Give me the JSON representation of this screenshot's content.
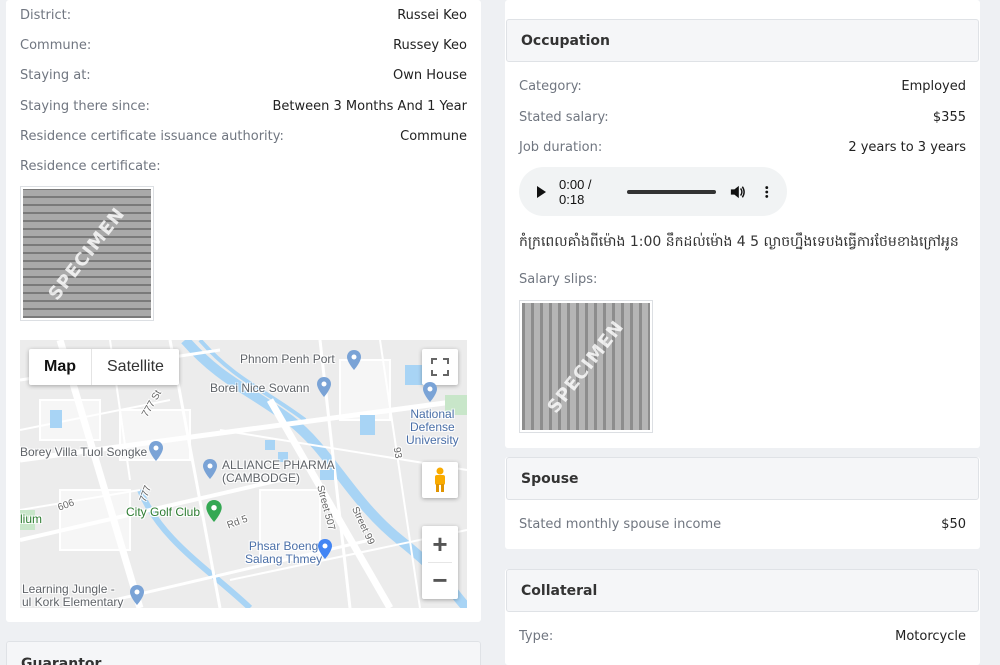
{
  "residence": {
    "fields": [
      {
        "label": "District:",
        "value": "Russei Keo"
      },
      {
        "label": "Commune:",
        "value": "Russey Keo"
      },
      {
        "label": "Staying at:",
        "value": "Own House"
      },
      {
        "label": "Staying there since:",
        "value": "Between 3 Months And 1 Year"
      },
      {
        "label": "Residence certificate issuance authority:",
        "value": "Commune"
      }
    ],
    "certificate_label": "Residence certificate:",
    "watermark": "SPECIMEN"
  },
  "map": {
    "type_map": "Map",
    "type_satellite": "Satellite",
    "zoom_in": "+",
    "zoom_out": "−",
    "places": {
      "phnom_penh_port": "Phnom Penh Port",
      "borei_nice": "Borei Nice Sovann",
      "national_defense": "National\nDefense\nUniversity",
      "borey_villa": "Borey Villa Tuol Songke",
      "alliance": "ALLIANCE PHARMA\n(CAMBODGE)",
      "city_golf": "City Golf Club",
      "phsar_boeng": "Phsar Boeng\nSalang Thmey",
      "learning_jungle": "Learning Jungle -\nul Kork Elementary",
      "lium": "lium"
    },
    "streets": {
      "s777_top": "777 St",
      "s777_mid": "777",
      "s99": "Street 99",
      "s507": "Street 507",
      "rd5": "Rd 5",
      "s93": "93",
      "s606": "606"
    }
  },
  "guarantor": {
    "title": "Guarantor"
  },
  "occupation": {
    "title": "Occupation",
    "fields": [
      {
        "label": "Category:",
        "value": "Employed"
      },
      {
        "label": "Stated salary:",
        "value": "$355"
      },
      {
        "label": "Job duration:",
        "value": "2 years to 3 years"
      }
    ],
    "audio_time": "0:00 / 0:18",
    "note": "កំក្រពេលគាំងពីម៉ោង 1:00 នឹកដល់ម៉ោង 4 5 ល្ងាចហ្នឹងទេបងធ្វើការថែមខាងក្រៅអូន",
    "salary_slips_label": "Salary slips:",
    "watermark": "SPECIMEN"
  },
  "spouse": {
    "title": "Spouse",
    "income_label": "Stated monthly spouse income",
    "income_value": "$50"
  },
  "collateral": {
    "title": "Collateral",
    "type_label": "Type:",
    "type_value": "Motorcycle"
  }
}
